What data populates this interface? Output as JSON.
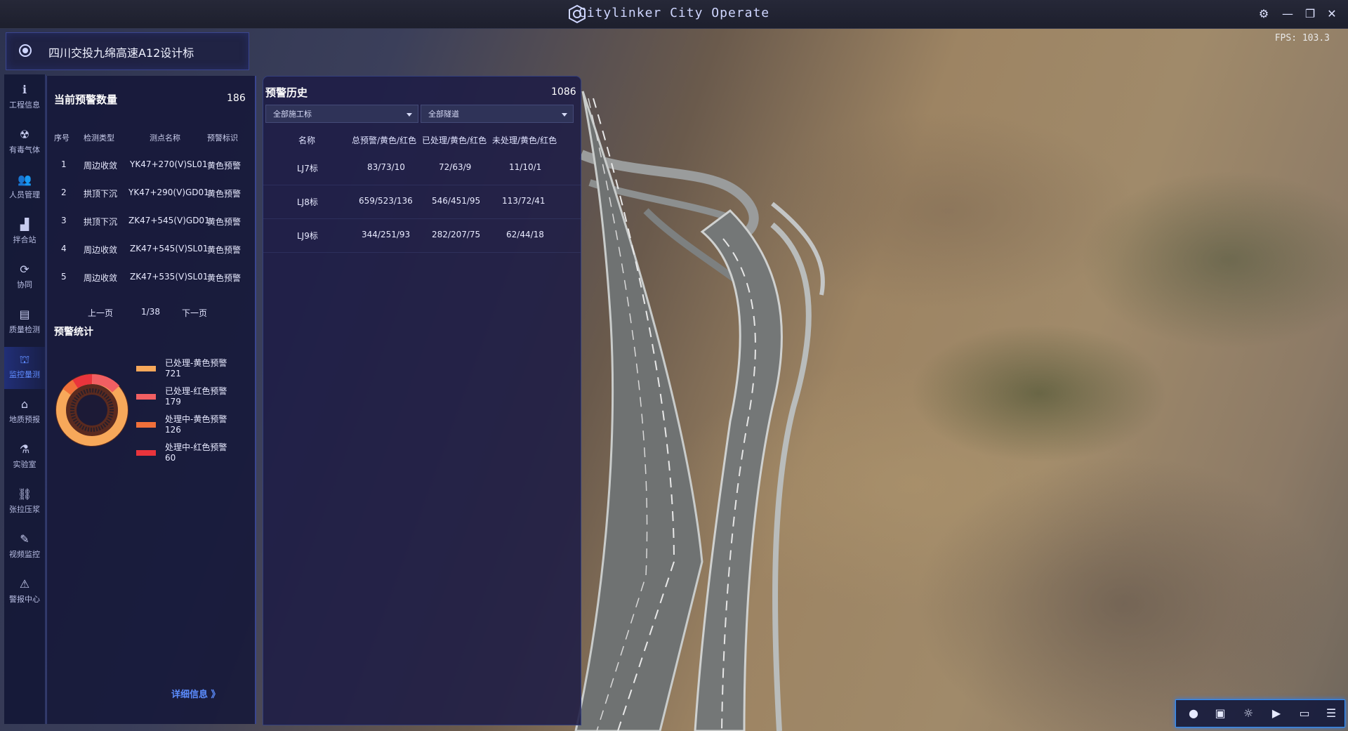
{
  "app": {
    "title": "Citylinker City Operate",
    "fps": "FPS: 103.3"
  },
  "project": {
    "name": "四川交投九绵高速A12设计标"
  },
  "sidebar": {
    "items": [
      {
        "label": "工程信息",
        "icon": "info-icon"
      },
      {
        "label": "有毒气体",
        "icon": "gas-icon"
      },
      {
        "label": "人员管理",
        "icon": "people-icon"
      },
      {
        "label": "拌合站",
        "icon": "chart-icon"
      },
      {
        "label": "协同",
        "icon": "sync-icon"
      },
      {
        "label": "质量检测",
        "icon": "folder-icon"
      },
      {
        "label": "监控量测",
        "icon": "monitor-icon",
        "active": true
      },
      {
        "label": "地质预报",
        "icon": "tunnel-icon"
      },
      {
        "label": "实验室",
        "icon": "lab-icon"
      },
      {
        "label": "张拉压浆",
        "icon": "tension-icon"
      },
      {
        "label": "视频监控",
        "icon": "camera-icon"
      },
      {
        "label": "警报中心",
        "icon": "alarm-icon"
      }
    ]
  },
  "warnings": {
    "title": "当前预警数量",
    "count": "186",
    "headers": [
      "序号",
      "检测类型",
      "测点名称",
      "预警标识"
    ],
    "rows": [
      {
        "no": "1",
        "type": "周边收敛",
        "point": "YK47+270(V)SL01",
        "flag": "黄色预警"
      },
      {
        "no": "2",
        "type": "拱顶下沉",
        "point": "YK47+290(V)GD01",
        "flag": "黄色预警"
      },
      {
        "no": "3",
        "type": "拱顶下沉",
        "point": "ZK47+545(V)GD01",
        "flag": "黄色预警"
      },
      {
        "no": "4",
        "type": "周边收敛",
        "point": "ZK47+545(V)SL01",
        "flag": "黄色预警"
      },
      {
        "no": "5",
        "type": "周边收敛",
        "point": "ZK47+535(V)SL01",
        "flag": "黄色预警"
      }
    ],
    "pager": {
      "prev": "上一页",
      "page": "1/38",
      "next": "下一页"
    }
  },
  "stats": {
    "title": "预警统计",
    "legend": [
      {
        "label": "已处理-黄色预警",
        "value": "721",
        "color": "#f7a85a"
      },
      {
        "label": "已处理-红色预警",
        "value": "179",
        "color": "#f15f62"
      },
      {
        "label": "处理中-黄色预警",
        "value": "126",
        "color": "#f0703a"
      },
      {
        "label": "处理中-红色预警",
        "value": "60",
        "color": "#e9343c"
      }
    ],
    "detail_link": "详细信息 》"
  },
  "history": {
    "title": "预警历史",
    "count": "1086",
    "filter_section": "全部施工标",
    "filter_tunnel": "全部隧道",
    "headers": [
      "名称",
      "总预警/黄色/红色",
      "已处理/黄色/红色",
      "未处理/黄色/红色"
    ],
    "rows": [
      {
        "name": "LJ7标",
        "total": "83/73/10",
        "handled": "72/63/9",
        "pending": "11/10/1"
      },
      {
        "name": "LJ8标",
        "total": "659/523/136",
        "handled": "546/451/95",
        "pending": "113/72/41"
      },
      {
        "name": "LJ9标",
        "total": "344/251/93",
        "handled": "282/207/75",
        "pending": "62/44/18"
      }
    ]
  },
  "toolbar": {
    "items": [
      "marker-icon",
      "camera-bag-icon",
      "sun-icon",
      "video-icon",
      "ruler-icon",
      "list-icon"
    ]
  }
}
